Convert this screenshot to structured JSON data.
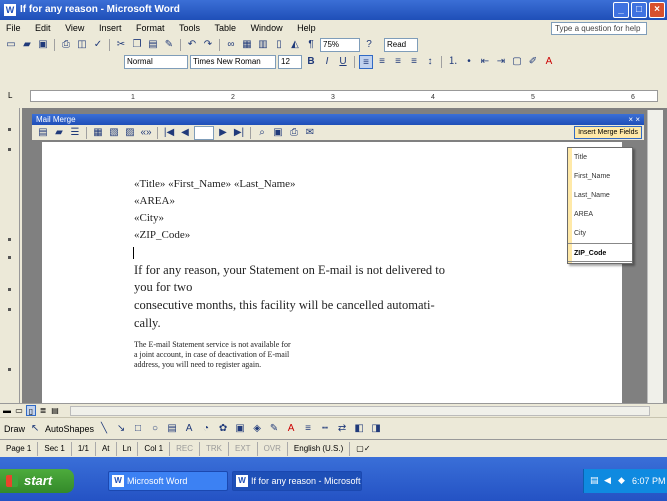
{
  "window": {
    "title": "If for any reason - Microsoft Word"
  },
  "menu": [
    "File",
    "Edit",
    "View",
    "Insert",
    "Format",
    "Tools",
    "Table",
    "Window",
    "Help"
  ],
  "help_placeholder": "Type a question for help",
  "formatting": {
    "zoom": "75%",
    "style": "Normal",
    "font": "Times New Roman",
    "size": "12",
    "read_label": "Read"
  },
  "mail_merge": {
    "title": "Mail Merge",
    "insert_fields_label": "Insert Merge Fields"
  },
  "document": {
    "fields": [
      "«Title» «First_Name» «Last_Name»",
      "«AREA»",
      "«City»",
      "«ZIP_Code»"
    ],
    "body": [
      "If for any reason, your Statement on E-mail is not delivered to",
      "you for two",
      "consecutive months, this facility will be cancelled automati-",
      "cally."
    ],
    "small": [
      "The E-mail Statement service is not available for",
      "a joint account, in case of deactivation of E-mail",
      "address, you will need to register again."
    ]
  },
  "merge_fields_dropdown": [
    "Title",
    "First_Name",
    "Last_Name",
    "AREA",
    "City",
    "ZIP_Code"
  ],
  "draw_label": "Draw",
  "autoshapes_label": "AutoShapes",
  "status": {
    "page": "Page 1",
    "sec": "Sec 1",
    "pages": "1/1",
    "at": "At",
    "ln": "Ln",
    "col": "Col 1",
    "modes": [
      "REC",
      "TRK",
      "EXT",
      "OVR"
    ],
    "lang": "English (U.S.)"
  },
  "taskbar": {
    "start": "start",
    "tasks": [
      "Microsoft Word",
      "If for any reason - Microsoft Word"
    ],
    "clock": "6:07 PM"
  },
  "colors": {
    "title_blue": "#1f4fb8",
    "taskbar_blue": "#2452c4",
    "start_green": "#3fa53c",
    "dropdown_accent": "#ffe9a8"
  }
}
